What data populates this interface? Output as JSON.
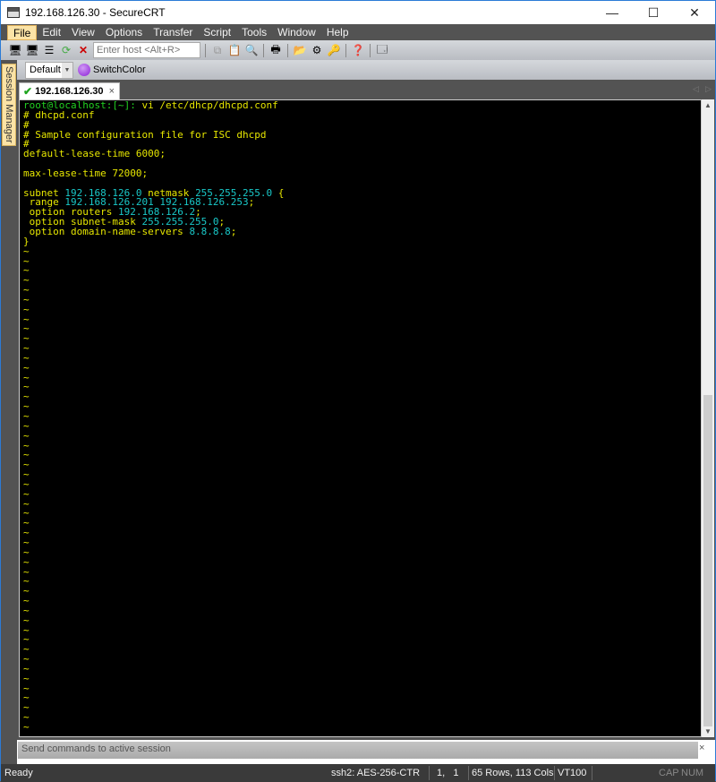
{
  "window": {
    "title": "192.168.126.30 - SecureCRT",
    "minimize": "—",
    "maximize": "☐",
    "close": "✕"
  },
  "menu": [
    "File",
    "Edit",
    "View",
    "Options",
    "Transfer",
    "Script",
    "Tools",
    "Window",
    "Help"
  ],
  "toolbar": {
    "host_placeholder": "Enter host <Alt+R>"
  },
  "sidebar": {
    "label": "Session Manager"
  },
  "buttonbar": {
    "preset": "Default",
    "switchcolor": "SwitchColor"
  },
  "tab": {
    "label": "192.168.126.30",
    "close": "×"
  },
  "terminal": {
    "lines": [
      [
        [
          "g",
          "root@localhost:[~]: "
        ],
        [
          "y",
          "vi /etc/dhcp/dhcpd.conf"
        ]
      ],
      [
        [
          "y",
          "# dhcpd.conf"
        ]
      ],
      [
        [
          "y",
          "#"
        ]
      ],
      [
        [
          "y",
          "# Sample configuration file for ISC dhcpd"
        ]
      ],
      [
        [
          "y",
          "#"
        ]
      ],
      [
        [
          "y",
          "default-lease-time 6000;"
        ]
      ],
      [],
      [
        [
          "y",
          "max-lease-time 72000;"
        ]
      ],
      [],
      [
        [
          "y",
          "subnet "
        ],
        [
          "c",
          "192.168.126.0"
        ],
        [
          "y",
          " netmask "
        ],
        [
          "c",
          "255.255.255.0"
        ],
        [
          "y",
          " {"
        ]
      ],
      [
        [
          "y",
          " range "
        ],
        [
          "c",
          "192.168.126.201 192.168.126.253"
        ],
        [
          "y",
          ";"
        ]
      ],
      [
        [
          "y",
          " option routers "
        ],
        [
          "c",
          "192.168.126.2"
        ],
        [
          "y",
          ";"
        ]
      ],
      [
        [
          "y",
          " option subnet-mask "
        ],
        [
          "c",
          "255.255.255.0"
        ],
        [
          "y",
          ";"
        ]
      ],
      [
        [
          "y",
          " option domain-name-servers "
        ],
        [
          "c",
          "8.8.8.8"
        ],
        [
          "y",
          ";"
        ]
      ],
      [
        [
          "y",
          "}"
        ]
      ]
    ],
    "empty_marker": "~",
    "empty_count": 50
  },
  "command_window": {
    "placeholder": "Send commands to active session",
    "close": "×"
  },
  "status": {
    "ready": "Ready",
    "cipher": "ssh2: AES-256-CTR",
    "cursor": "1,   1",
    "size": "65 Rows, 113 Cols",
    "emulation": "VT100",
    "cap": "CAP",
    "num": "NUM"
  }
}
